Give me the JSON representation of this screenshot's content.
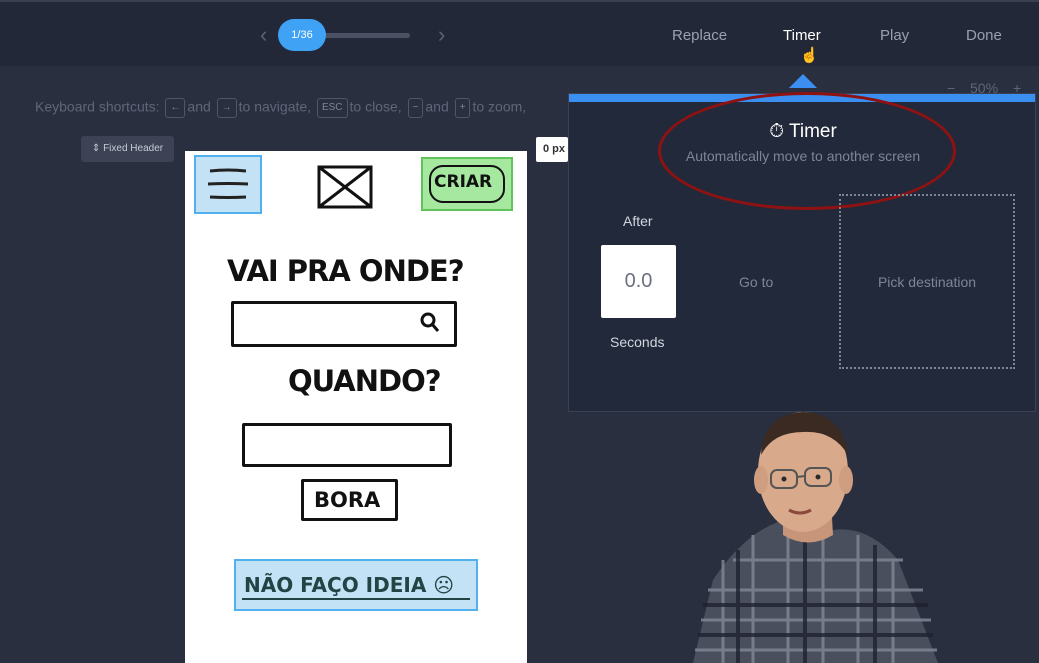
{
  "topbar": {
    "progress_label": "1/36",
    "prev_icon": "chevron-left-icon",
    "next_icon": "chevron-right-icon",
    "menu": [
      {
        "label": "Replace",
        "active": false
      },
      {
        "label": "Timer",
        "active": true
      },
      {
        "label": "Play",
        "active": false
      },
      {
        "label": "Done",
        "active": false
      }
    ]
  },
  "shortcuts": {
    "prefix": "Keyboard shortcuts:",
    "left_key": "←",
    "and1": "and",
    "right_key": "→",
    "navigate": "to navigate,",
    "esc_key": "ESC",
    "close": "to close,",
    "minus_key": "−",
    "and2": "and",
    "plus_key": "+",
    "zoom": "to zoom,"
  },
  "zoom": {
    "minus": "−",
    "level": "50%",
    "plus": "+"
  },
  "fixed_header_label": "Fixed Header",
  "offset_value": "0 px",
  "canvas": {
    "question1": "VAI PRA ONDE?",
    "question2": "QUANDO?",
    "create_button": "CRIAR",
    "go_button": "BORA",
    "idea_button": "NÃO FAÇO IDEIA ☹"
  },
  "timer_panel": {
    "icon": "stopwatch-icon",
    "title": "Timer",
    "subtitle": "Automatically move to another screen",
    "after_label": "After",
    "seconds_value": "0.0",
    "seconds_label": "Seconds",
    "goto_label": "Go to",
    "destination_label": "Pick destination"
  },
  "colors": {
    "accent": "#3fa2f5",
    "panel_bar": "#3a8ff0",
    "hotspot_blue": "#c4e2f6",
    "hotspot_green": "#a6e8a0",
    "annotation_ellipse": "#8f1212"
  }
}
